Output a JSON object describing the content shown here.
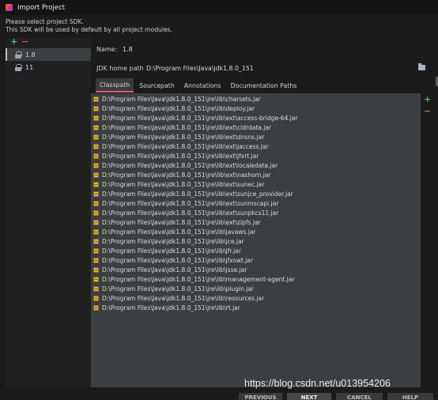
{
  "window": {
    "title": "Import Project"
  },
  "description": {
    "line1": "Please select project SDK.",
    "line2": "This SDK will be used by default by all project modules."
  },
  "sdk_toolbar": {
    "add": "+",
    "remove": "−"
  },
  "sdk_list": [
    {
      "label": "1.8",
      "icon": "sdk-icon",
      "selected": true
    },
    {
      "label": "11",
      "icon": "sdk-icon",
      "selected": false
    }
  ],
  "details": {
    "name_label": "Name:",
    "name_value": "1.8",
    "jdk_home_label": "JDK home path:",
    "jdk_home_value": "D:\\Program Files\\Java\\jdk1.8.0_151"
  },
  "tabs": [
    {
      "label": "Classpath",
      "active": true
    },
    {
      "label": "Sourcepath",
      "active": false
    },
    {
      "label": "Annotations",
      "active": false
    },
    {
      "label": "Documentation Paths",
      "active": false
    }
  ],
  "classpath": [
    "D:\\Program Files\\Java\\jdk1.8.0_151\\jre\\lib\\charsets.jar",
    "D:\\Program Files\\Java\\jdk1.8.0_151\\jre\\lib\\deploy.jar",
    "D:\\Program Files\\Java\\jdk1.8.0_151\\jre\\lib\\ext\\access-bridge-64.jar",
    "D:\\Program Files\\Java\\jdk1.8.0_151\\jre\\lib\\ext\\cldrdata.jar",
    "D:\\Program Files\\Java\\jdk1.8.0_151\\jre\\lib\\ext\\dnsns.jar",
    "D:\\Program Files\\Java\\jdk1.8.0_151\\jre\\lib\\ext\\jaccess.jar",
    "D:\\Program Files\\Java\\jdk1.8.0_151\\jre\\lib\\ext\\jfxrt.jar",
    "D:\\Program Files\\Java\\jdk1.8.0_151\\jre\\lib\\ext\\localedata.jar",
    "D:\\Program Files\\Java\\jdk1.8.0_151\\jre\\lib\\ext\\nashorn.jar",
    "D:\\Program Files\\Java\\jdk1.8.0_151\\jre\\lib\\ext\\sunec.jar",
    "D:\\Program Files\\Java\\jdk1.8.0_151\\jre\\lib\\ext\\sunjce_provider.jar",
    "D:\\Program Files\\Java\\jdk1.8.0_151\\jre\\lib\\ext\\sunmscapi.jar",
    "D:\\Program Files\\Java\\jdk1.8.0_151\\jre\\lib\\ext\\sunpkcs11.jar",
    "D:\\Program Files\\Java\\jdk1.8.0_151\\jre\\lib\\ext\\zipfs.jar",
    "D:\\Program Files\\Java\\jdk1.8.0_151\\jre\\lib\\javaws.jar",
    "D:\\Program Files\\Java\\jdk1.8.0_151\\jre\\lib\\jce.jar",
    "D:\\Program Files\\Java\\jdk1.8.0_151\\jre\\lib\\jfr.jar",
    "D:\\Program Files\\Java\\jdk1.8.0_151\\jre\\lib\\jfxswt.jar",
    "D:\\Program Files\\Java\\jdk1.8.0_151\\jre\\lib\\jsse.jar",
    "D:\\Program Files\\Java\\jdk1.8.0_151\\jre\\lib\\management-agent.jar",
    "D:\\Program Files\\Java\\jdk1.8.0_151\\jre\\lib\\plugin.jar",
    "D:\\Program Files\\Java\\jdk1.8.0_151\\jre\\lib\\resources.jar",
    "D:\\Program Files\\Java\\jdk1.8.0_151\\jre\\lib\\rt.jar"
  ],
  "classpath_toolbar": {
    "add": "+",
    "remove": "−"
  },
  "buttons": {
    "previous": "PREVIOUS",
    "next": "NEXT",
    "cancel": "CANCEL",
    "help": "HELP"
  },
  "watermark": "https://blog.csdn.net/u013954206",
  "colors": {
    "accent": "#e0557a",
    "add": "#4fbf6b",
    "remove": "#d65757",
    "jar": "#d9b43a"
  }
}
